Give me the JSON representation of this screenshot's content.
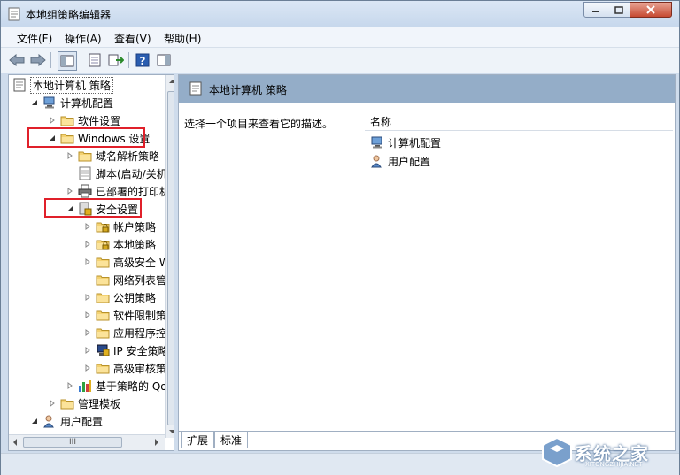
{
  "window": {
    "title": "本地组策略编辑器"
  },
  "menu": [
    "文件(F)",
    "操作(A)",
    "查看(V)",
    "帮助(H)"
  ],
  "tree": [
    {
      "label": "本地计算机 策略",
      "indent": 0,
      "arrow": "none",
      "icon": "policy-icon",
      "selected": true
    },
    {
      "label": "计算机配置",
      "indent": 1,
      "arrow": "expanded",
      "icon": "computer-icon"
    },
    {
      "label": "软件设置",
      "indent": 2,
      "arrow": "collapsed",
      "icon": "folder-icon"
    },
    {
      "label": "Windows 设置",
      "indent": 2,
      "arrow": "expanded",
      "icon": "folder-icon"
    },
    {
      "label": "域名解析策略",
      "indent": 3,
      "arrow": "collapsed",
      "icon": "folder-icon"
    },
    {
      "label": "脚本(启动/关机)",
      "indent": 3,
      "arrow": "none",
      "icon": "script-icon"
    },
    {
      "label": "已部署的打印机",
      "indent": 3,
      "arrow": "collapsed",
      "icon": "printer-icon"
    },
    {
      "label": "安全设置",
      "indent": 3,
      "arrow": "expanded",
      "icon": "security-icon"
    },
    {
      "label": "帐户策略",
      "indent": 4,
      "arrow": "collapsed",
      "icon": "lock-folder-icon"
    },
    {
      "label": "本地策略",
      "indent": 4,
      "arrow": "collapsed",
      "icon": "lock-folder-icon"
    },
    {
      "label": "高级安全 Wi",
      "indent": 4,
      "arrow": "collapsed",
      "icon": "folder-icon"
    },
    {
      "label": "网络列表管理",
      "indent": 4,
      "arrow": "none",
      "icon": "folder-icon"
    },
    {
      "label": "公钥策略",
      "indent": 4,
      "arrow": "collapsed",
      "icon": "folder-icon"
    },
    {
      "label": "软件限制策略",
      "indent": 4,
      "arrow": "collapsed",
      "icon": "folder-icon"
    },
    {
      "label": "应用程序控制",
      "indent": 4,
      "arrow": "collapsed",
      "icon": "folder-icon"
    },
    {
      "label": "IP 安全策略",
      "indent": 4,
      "arrow": "collapsed",
      "icon": "ipsec-icon"
    },
    {
      "label": "高级审核策略",
      "indent": 4,
      "arrow": "collapsed",
      "icon": "folder-icon"
    },
    {
      "label": "基于策略的 QoS",
      "indent": 3,
      "arrow": "collapsed",
      "icon": "chart-icon"
    },
    {
      "label": "管理模板",
      "indent": 2,
      "arrow": "collapsed",
      "icon": "folder-icon"
    },
    {
      "label": "用户配置",
      "indent": 1,
      "arrow": "expanded",
      "icon": "user-icon"
    }
  ],
  "right": {
    "header_title": "本地计算机 策略",
    "description": "选择一个项目来查看它的描述。",
    "column_name": "名称",
    "items": [
      {
        "label": "计算机配置",
        "icon": "computer-icon"
      },
      {
        "label": "用户配置",
        "icon": "user-icon"
      }
    ],
    "tabs": [
      "扩展",
      "标准"
    ]
  },
  "hscroll_label": "III",
  "watermark": {
    "text": "系统之家",
    "sub": "XITONGZHIJIA.NET"
  }
}
